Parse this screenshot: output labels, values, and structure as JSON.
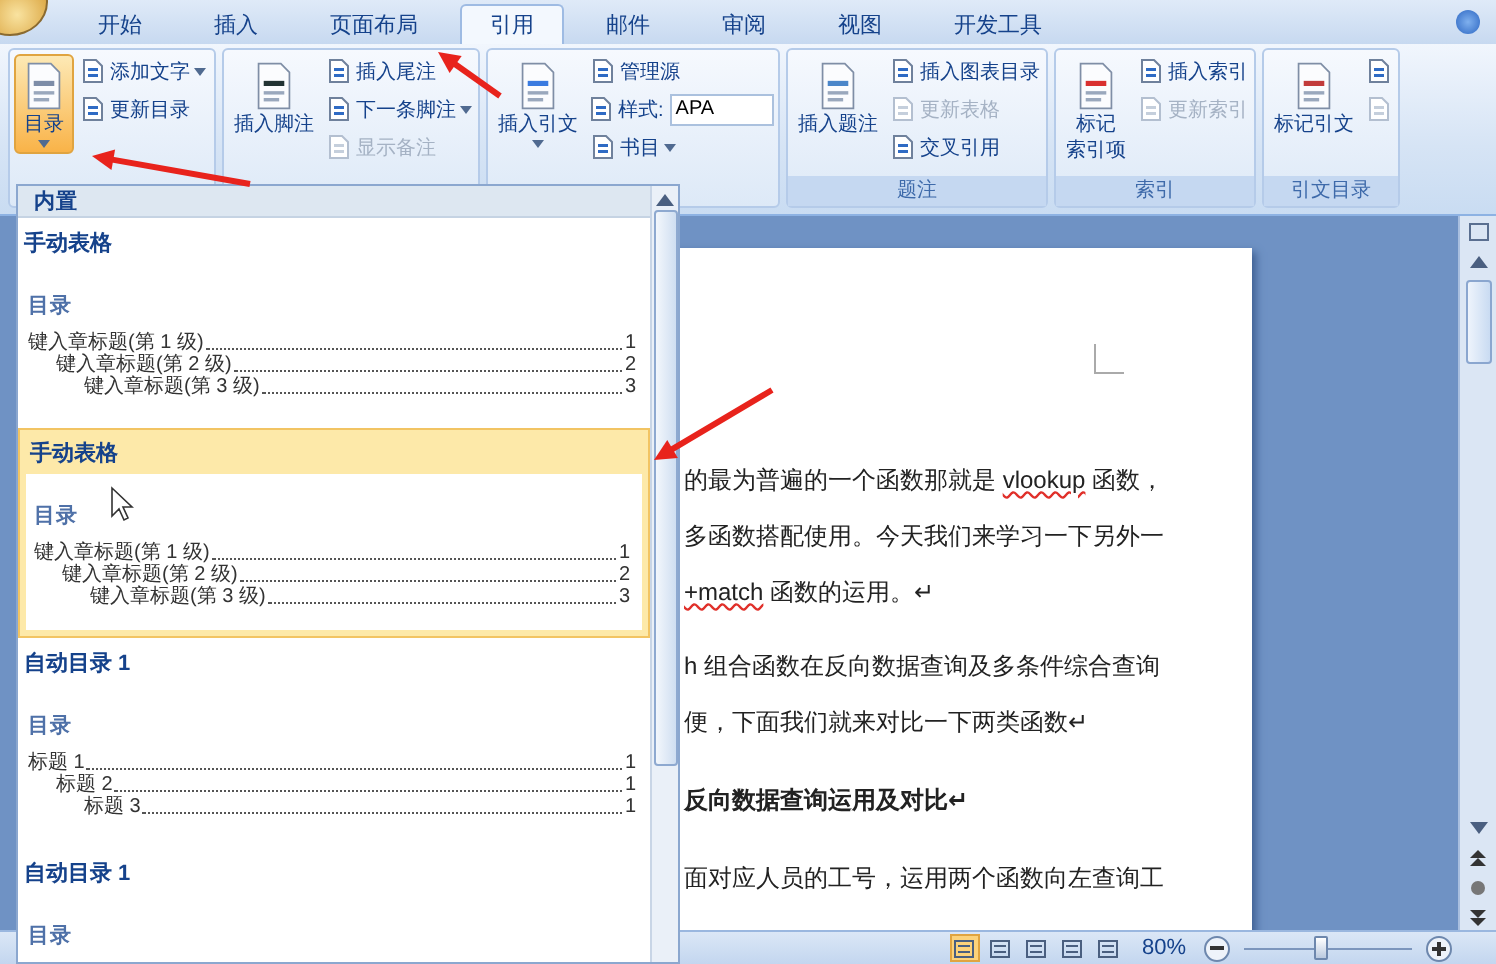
{
  "tabs": [
    {
      "label": "开始",
      "selected": false
    },
    {
      "label": "插入",
      "selected": false
    },
    {
      "label": "页面布局",
      "selected": false
    },
    {
      "label": "引用",
      "selected": true
    },
    {
      "label": "邮件",
      "selected": false
    },
    {
      "label": "审阅",
      "selected": false
    },
    {
      "label": "视图",
      "selected": false
    },
    {
      "label": "开发工具",
      "selected": false
    }
  ],
  "ribbon": {
    "groups": [
      {
        "large": {
          "lines": [
            "目录"
          ],
          "caret": true,
          "pressed": true
        },
        "small": [
          {
            "kind": "button",
            "label": "添加文字",
            "caret": true,
            "disabled": false
          },
          {
            "kind": "button",
            "label": "更新目录",
            "caret": false,
            "disabled": false
          }
        ]
      },
      {
        "large": {
          "lines": [
            "插入脚注"
          ],
          "caret": false,
          "pressed": false
        },
        "small": [
          {
            "kind": "button",
            "label": "插入尾注",
            "caret": false,
            "disabled": false
          },
          {
            "kind": "button",
            "label": "下一条脚注",
            "caret": true,
            "disabled": false
          },
          {
            "kind": "button",
            "label": "显示备注",
            "caret": false,
            "disabled": true
          }
        ]
      },
      {
        "large": {
          "lines": [
            "插入引文"
          ],
          "caret": true,
          "pressed": false
        },
        "small": [
          {
            "kind": "button",
            "label": "管理源",
            "caret": false,
            "disabled": false
          },
          {
            "kind": "combo",
            "label": "样式:",
            "value": "APA",
            "disabled": false
          },
          {
            "kind": "button",
            "label": "书目",
            "caret": true,
            "disabled": false
          }
        ]
      },
      {
        "label": "题注",
        "large": {
          "lines": [
            "插入题注"
          ],
          "caret": false,
          "pressed": false
        },
        "small": [
          {
            "kind": "button",
            "label": "插入图表目录",
            "caret": false,
            "disabled": false
          },
          {
            "kind": "button",
            "label": "更新表格",
            "caret": false,
            "disabled": true
          },
          {
            "kind": "button",
            "label": "交叉引用",
            "caret": false,
            "disabled": false
          }
        ]
      },
      {
        "label": "索引",
        "large": {
          "lines": [
            "标记",
            "索引项"
          ],
          "caret": false,
          "pressed": false
        },
        "small": [
          {
            "kind": "button",
            "label": "插入索引",
            "caret": false,
            "disabled": false
          },
          {
            "kind": "button",
            "label": "更新索引",
            "caret": false,
            "disabled": true
          }
        ]
      },
      {
        "label": "引文目录",
        "large": {
          "lines": [
            "标记引文"
          ],
          "caret": false,
          "pressed": false
        },
        "small": [
          {
            "kind": "icon",
            "disabled": false
          },
          {
            "kind": "icon",
            "disabled": true
          }
        ]
      }
    ]
  },
  "gallery": {
    "header": "内置",
    "entries": [
      {
        "title": "手动表格",
        "selected": false,
        "preview": {
          "heading": "目录",
          "lines": [
            {
              "text": "键入章标题(第 1 级)",
              "page": "1",
              "children": [
                {
                  "text": "键入章标题(第 2 级)",
                  "page": "2",
                  "children": [
                    {
                      "text": "键入章标题(第 3 级)",
                      "page": "3"
                    }
                  ]
                }
              ]
            }
          ]
        }
      },
      {
        "title": "手动表格",
        "selected": true,
        "preview": {
          "heading": "目录",
          "lines": [
            {
              "text": "键入章标题(第 1 级)",
              "page": "1",
              "children": [
                {
                  "text": "键入章标题(第 2 级)",
                  "page": "2",
                  "children": [
                    {
                      "text": "键入章标题(第 3 级)",
                      "page": "3"
                    }
                  ]
                }
              ]
            }
          ]
        }
      },
      {
        "title": "自动目录 1",
        "selected": false,
        "preview": {
          "heading": "目录",
          "lines": [
            {
              "text": "标题 1",
              "page": "1",
              "children": [
                {
                  "text": "标题 2",
                  "page": "1",
                  "children": [
                    {
                      "text": "标题 3",
                      "page": "1"
                    }
                  ]
                }
              ]
            }
          ]
        }
      },
      {
        "title": "自动目录 1",
        "selected": false,
        "preview": {
          "heading": "目录"
        }
      }
    ]
  },
  "document": {
    "paragraphs": [
      {
        "bold": false,
        "segments": [
          {
            "text": "的最为普遍的一个函数那就是 ",
            "misspelled": false
          },
          {
            "text": "vlookup",
            "misspelled": true
          },
          {
            "text": " 函数，",
            "misspelled": false
          }
        ]
      },
      {
        "bold": false,
        "segments": [
          {
            "text": "多函数搭配使用。今天我们来学习一下另外一",
            "misspelled": false
          }
        ]
      },
      {
        "bold": false,
        "segments": [
          {
            "text": "+match",
            "misspelled": true
          },
          {
            "text": " 函数的运用。↵",
            "misspelled": false
          }
        ]
      },
      {
        "bold": false,
        "segments": [
          {
            "text": "h 组合函数在反向数据查询及多条件综合查询",
            "misspelled": false
          }
        ]
      },
      {
        "bold": false,
        "segments": [
          {
            "text": "便，下面我们就来对比一下两类函数↵",
            "misspelled": false
          }
        ]
      },
      {
        "bold": true,
        "segments": [
          {
            "text": "反向数据查询运用及对比↵",
            "misspelled": false
          }
        ]
      },
      {
        "bold": false,
        "segments": [
          {
            "text": "面对应人员的工号，运用两个函数向左查询工",
            "misspelled": false
          }
        ]
      }
    ]
  },
  "status_bar": {
    "views": [
      {
        "selected": true
      },
      {
        "selected": false
      },
      {
        "selected": false
      },
      {
        "selected": false
      },
      {
        "selected": false
      }
    ],
    "zoom": "80%",
    "zoom_slider": {
      "level": 0.45
    }
  }
}
